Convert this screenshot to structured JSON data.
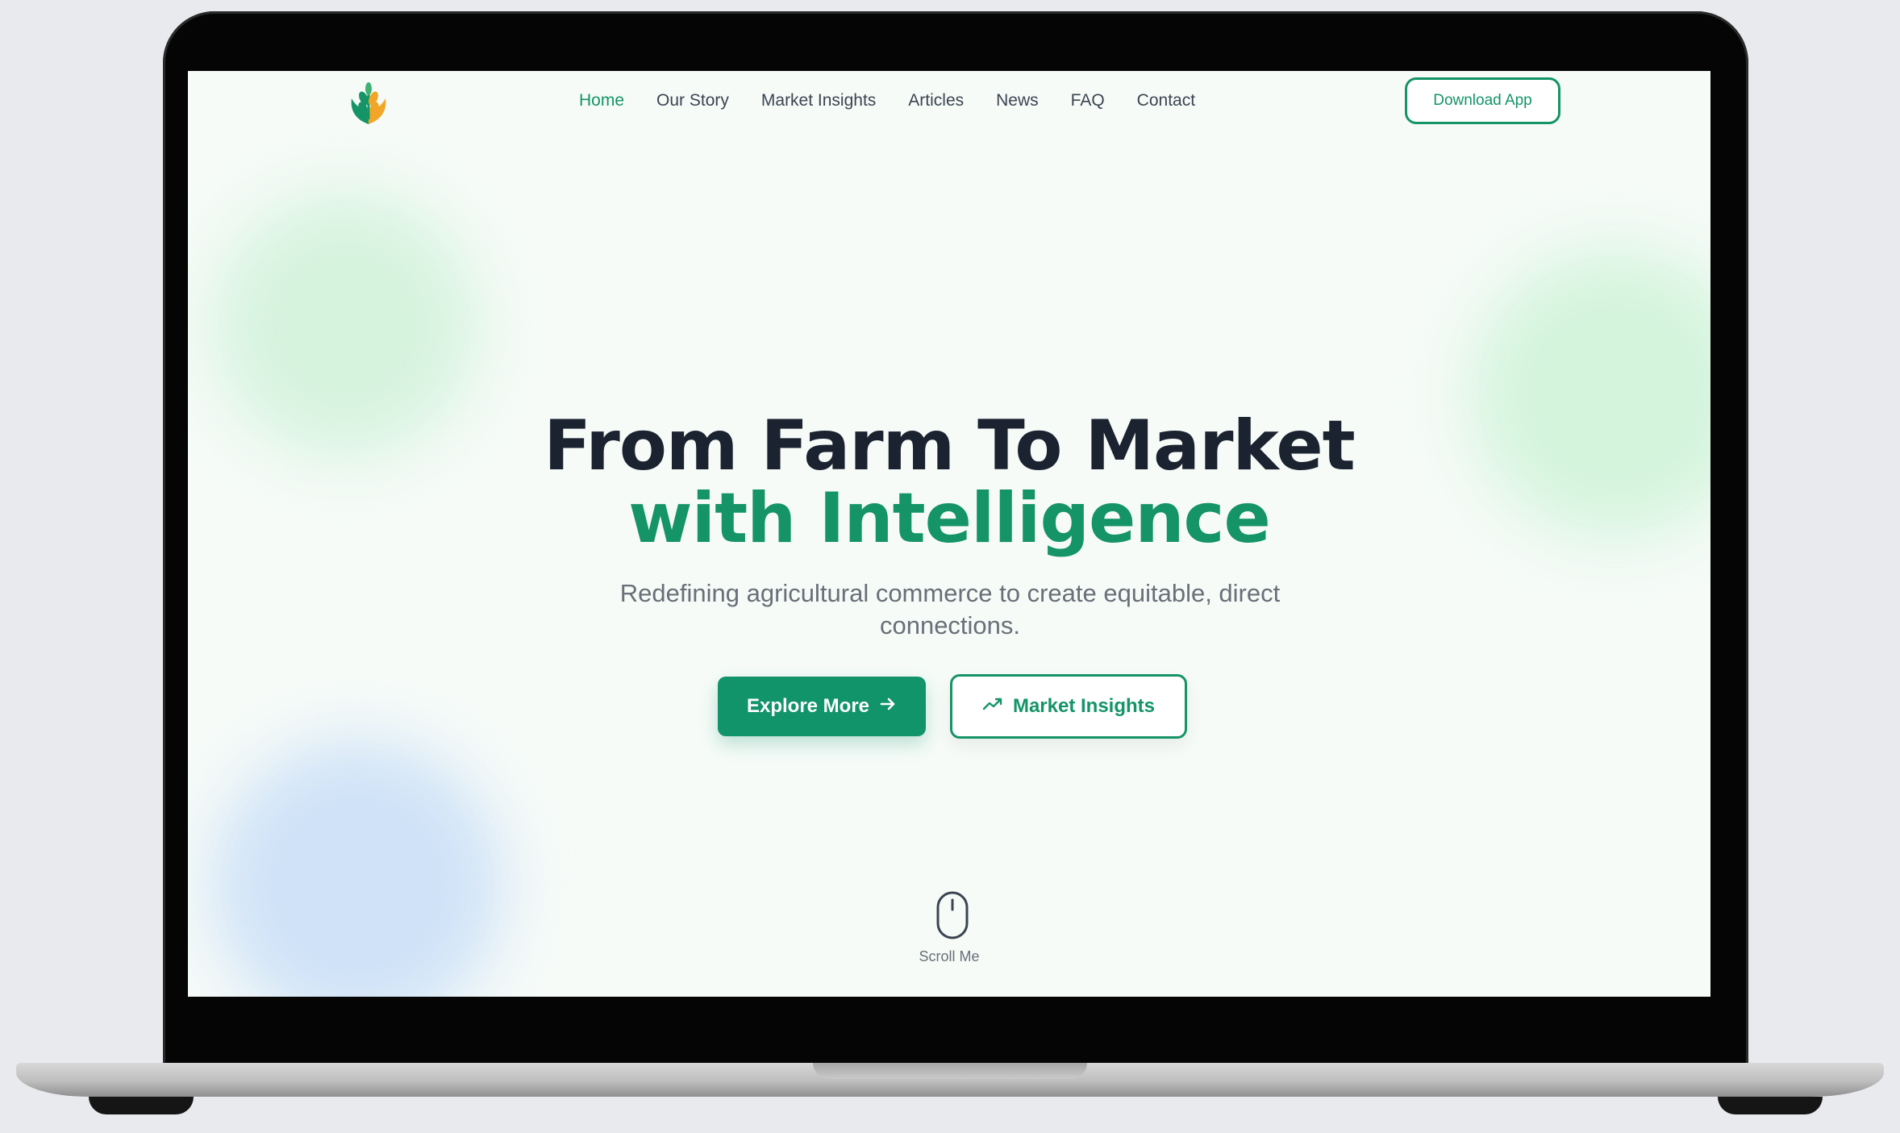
{
  "nav": {
    "logo_icon": "wheat-leaf-icon",
    "items": [
      {
        "label": "Home",
        "active": true
      },
      {
        "label": "Our Story",
        "active": false
      },
      {
        "label": "Market Insights",
        "active": false
      },
      {
        "label": "Articles",
        "active": false
      },
      {
        "label": "News",
        "active": false
      },
      {
        "label": "FAQ",
        "active": false
      },
      {
        "label": "Contact",
        "active": false
      }
    ],
    "download_label": "Download App"
  },
  "hero": {
    "title_line1": "From Farm To Market",
    "title_line2": "with Intelligence",
    "subtitle": "Redefining agricultural commerce to create equitable, direct connections.",
    "primary_button": "Explore More",
    "primary_icon": "arrow-right-icon",
    "secondary_button": "Market Insights",
    "secondary_icon": "trending-up-icon",
    "scroll_label": "Scroll Me",
    "scroll_icon": "mouse-icon"
  },
  "colors": {
    "accent": "#149467",
    "heading": "#1b2230",
    "text_muted": "#6a6f78",
    "background": "#f6fbf8"
  }
}
